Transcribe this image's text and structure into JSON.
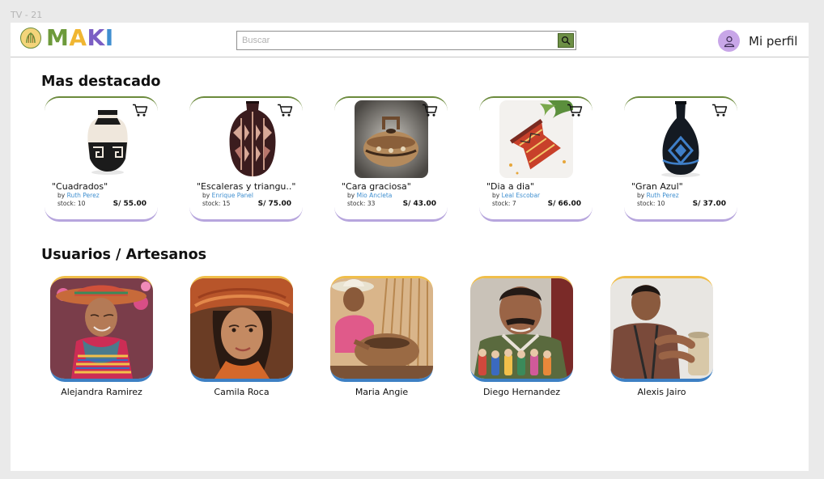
{
  "frame_label": "TV - 21",
  "logo": {
    "letters": [
      "M",
      "A",
      "K",
      "I"
    ],
    "letter_colors": [
      "#6d9a3b",
      "#f0b632",
      "#7b5ec4",
      "#3f8fd0"
    ]
  },
  "search": {
    "placeholder": "Buscar",
    "button_icon": "search-icon"
  },
  "profile": {
    "label": "Mi perfil",
    "icon": "user-icon",
    "avatar_color": "#c8a6e8"
  },
  "colors": {
    "accent_green": "#6d8f45",
    "card_top_border": "#6b8a3c",
    "card_bottom_border": "#b7a6dd",
    "user_top_border": "#f0be4a",
    "user_bottom_border": "#3d80c4",
    "artist_link": "#3f8fd0"
  },
  "featured": {
    "title": "Mas destacado",
    "products": [
      {
        "name": "\"Cuadrados\"",
        "by": "by",
        "artist": "Ruth Perez",
        "stock": "stock: 10",
        "price": "S/ 55.00"
      },
      {
        "name": "\"Escaleras y triangu..\"",
        "by": "by",
        "artist": "Enrique Panel",
        "stock": "stock: 15",
        "price": "S/ 75.00"
      },
      {
        "name": "\"Cara graciosa\"",
        "by": "by",
        "artist": "Mio Ancleta",
        "stock": "stock: 33",
        "price": "S/ 43.00"
      },
      {
        "name": "\"Dia a dia\"",
        "by": "by",
        "artist": "Leal Escobar",
        "stock": "stock: 7",
        "price": "S/ 66.00"
      },
      {
        "name": "\"Gran Azul\"",
        "by": "by",
        "artist": "Ruth Perez",
        "stock": "stock: 10",
        "price": "S/ 37.00"
      }
    ]
  },
  "users": {
    "title": "Usuarios / Artesanos",
    "items": [
      {
        "name": "Alejandra Ramirez"
      },
      {
        "name": "Camila Roca"
      },
      {
        "name": "Maria Angie"
      },
      {
        "name": "Diego Hernandez"
      },
      {
        "name": "Alexis Jairo"
      }
    ]
  }
}
